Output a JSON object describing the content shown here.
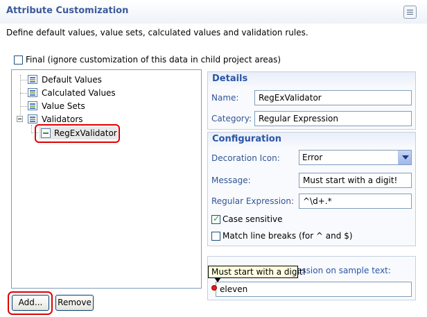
{
  "header": {
    "title": "Attribute Customization",
    "description": "Define default values, value sets, calculated values and validation rules."
  },
  "final_checkbox": {
    "label": "Final (ignore customization of this data in child project areas)",
    "checked": false
  },
  "tree": {
    "items": [
      {
        "label": "Default Values"
      },
      {
        "label": "Calculated Values"
      },
      {
        "label": "Value Sets"
      },
      {
        "label": "Validators"
      }
    ],
    "selected_child": {
      "label": "RegExValidator"
    }
  },
  "buttons": {
    "add": "Add...",
    "remove": "Remove"
  },
  "details": {
    "heading": "Details",
    "name_label": "Name:",
    "name_value": "RegExValidator",
    "category_label": "Category:",
    "category_value": "Regular Expression"
  },
  "configuration": {
    "heading": "Configuration",
    "decoration_label": "Decoration Icon:",
    "decoration_value": "Error",
    "message_label": "Message:",
    "message_value": "Must start with a digit!",
    "regex_label": "Regular Expression:",
    "regex_value": "^\\d+.*",
    "case_sensitive_label": "Case sensitive",
    "case_sensitive_checked": true,
    "match_line_breaks_label": "Match line breaks (for ^ and $)",
    "match_line_breaks_checked": false
  },
  "sample": {
    "heading": "ession on sample text:",
    "input_value": "eleven",
    "tooltip": "Must start with a digit!"
  },
  "colors": {
    "accent": "#2f5597",
    "highlight_ring": "#e00000",
    "error": "#e02020"
  }
}
